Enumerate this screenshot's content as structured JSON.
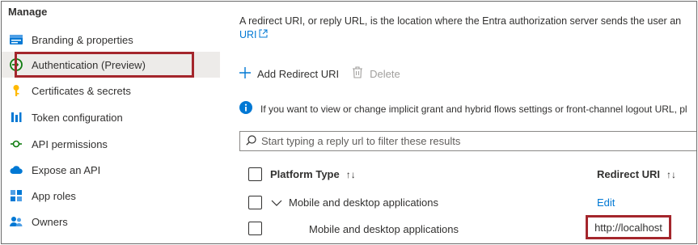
{
  "sidebar": {
    "section_title": "Manage",
    "items": [
      {
        "label": "Branding & properties",
        "icon": "branding-icon"
      },
      {
        "label": "Authentication (Preview)",
        "icon": "authentication-icon"
      },
      {
        "label": "Certificates & secrets",
        "icon": "key-icon"
      },
      {
        "label": "Token configuration",
        "icon": "token-icon"
      },
      {
        "label": "API permissions",
        "icon": "api-permissions-icon"
      },
      {
        "label": "Expose an API",
        "icon": "cloud-icon"
      },
      {
        "label": "App roles",
        "icon": "app-roles-icon"
      },
      {
        "label": "Owners",
        "icon": "owners-icon"
      }
    ],
    "active_item": "Authentication (Preview)"
  },
  "main": {
    "description": "A redirect URI, or reply URL, is the location where the Entra authorization server sends the user an",
    "description_link": "URI",
    "toolbar": {
      "add_label": "Add Redirect URI",
      "delete_label": "Delete"
    },
    "info_text": "If you want to view or change implicit grant and hybrid flows settings or front-channel logout URL, pl",
    "filter": {
      "placeholder": "Start typing a reply url to filter these results"
    },
    "table": {
      "col_platform": "Platform Type",
      "col_uri": "Redirect URI",
      "sort_glyph": "↑↓",
      "group_row": {
        "label": "Mobile and desktop applications",
        "action": "Edit"
      },
      "item_row": {
        "label": "Mobile and desktop applications",
        "uri": "http://localhost"
      }
    }
  },
  "colors": {
    "accent": "#0078d4",
    "highlight": "#a4262c",
    "active_bg": "#edebe9"
  }
}
